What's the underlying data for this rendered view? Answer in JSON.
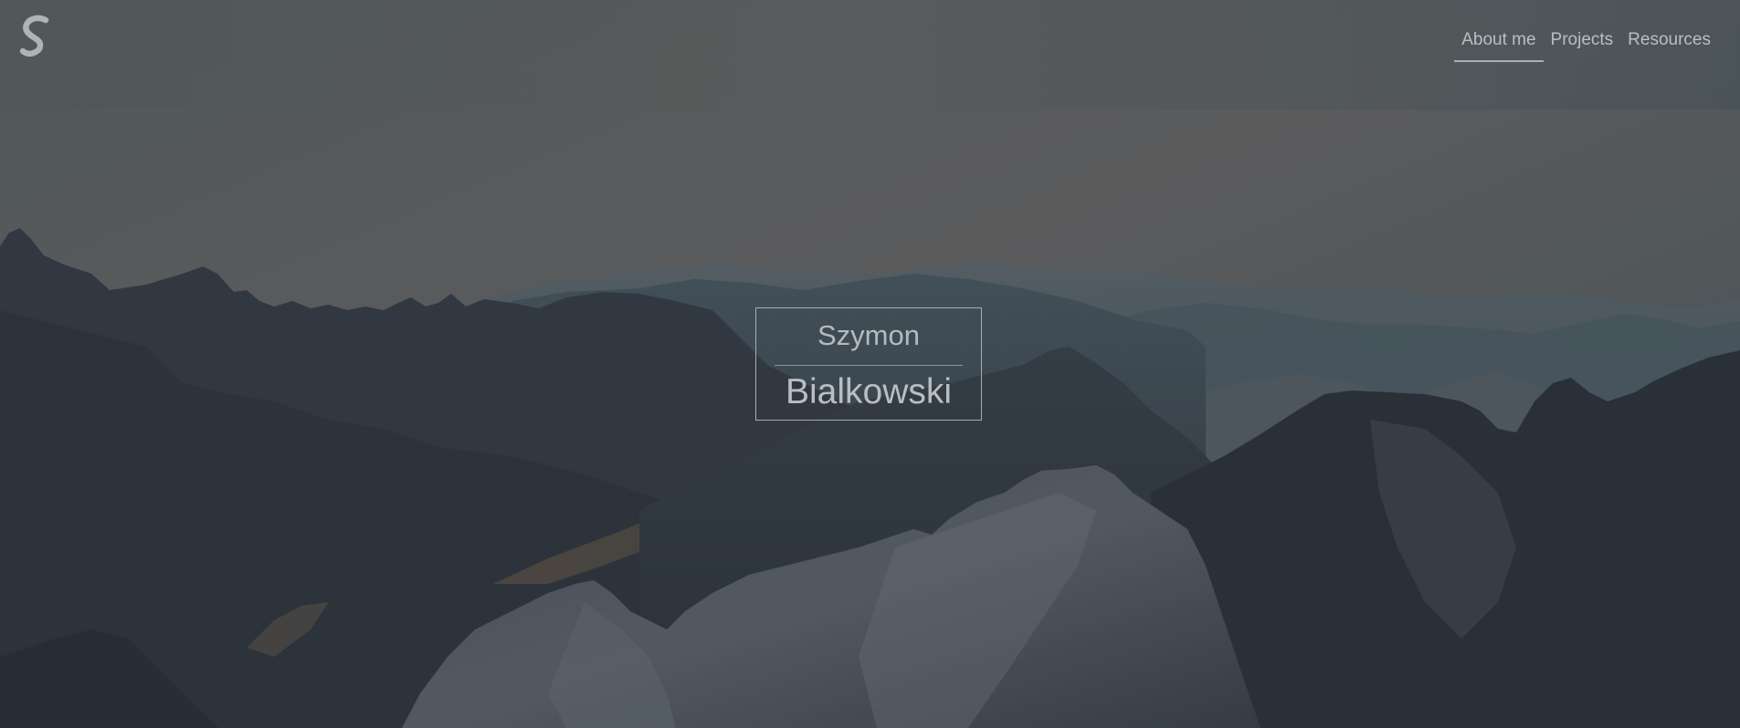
{
  "brand": {
    "logo_letter": "S",
    "logo_icon": "s-script-logo"
  },
  "nav": {
    "items": [
      {
        "label": "About me",
        "active": true
      },
      {
        "label": "Projects",
        "active": false
      },
      {
        "label": "Resources",
        "active": false
      }
    ]
  },
  "hero": {
    "first_name": "Szymon",
    "last_name": "Bialkowski",
    "background": "mountain-range-photo"
  },
  "colors": {
    "sky_top": "#4b5a60",
    "sky_mid": "#5f6667",
    "nav_text": "#b9bec2",
    "title_text": "#b5babe",
    "border": "#a7adb1"
  }
}
